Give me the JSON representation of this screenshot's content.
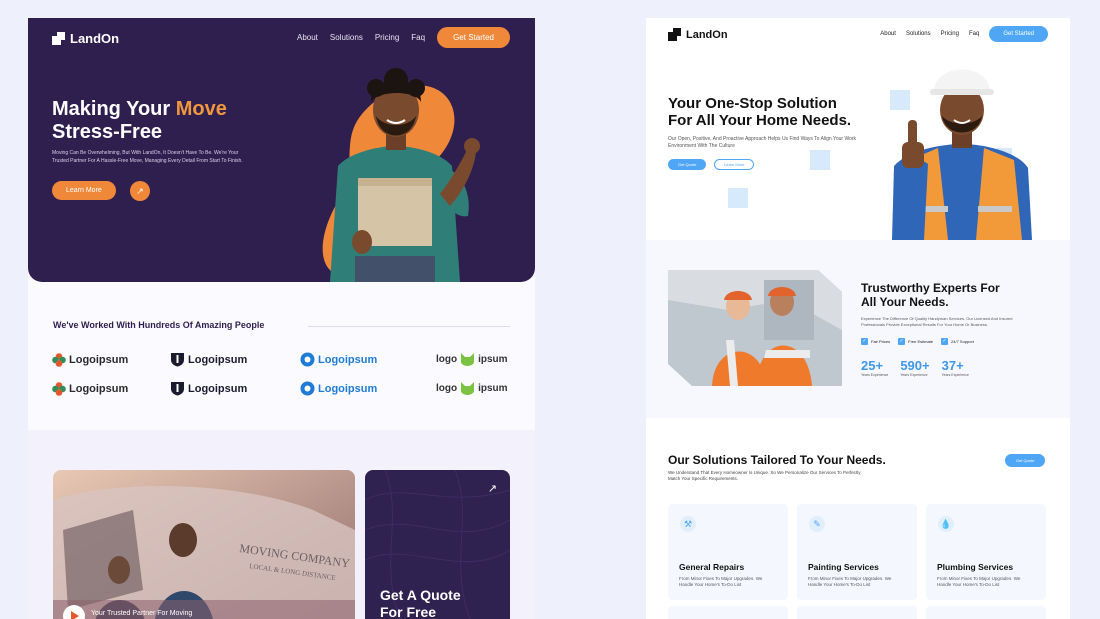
{
  "left": {
    "brand": "LandOn",
    "nav": [
      "About",
      "Solutions",
      "Pricing",
      "Faq"
    ],
    "cta": "Get Started",
    "hero": {
      "title_a": "Making Your ",
      "title_accent": "Move",
      "title_b": "Stress-Free",
      "desc": "Moving Can Be Overwhelming, But With LandOn, It Doesn't Have To Be. We're Your Trusted Partner For A Hassle-Free Move, Managing Every Detail From Start To Finish.",
      "button": "Learn More",
      "arrow": "↗"
    },
    "partners": {
      "heading": "We've Worked With Hundreds Of Amazing People",
      "logos": [
        "Logoipsum",
        "Logoipsum",
        "Logoipsum",
        "logo",
        "ipsum",
        "Logoipsum",
        "Logoipsum",
        "Logoipsum",
        "logo",
        "ipsum"
      ]
    },
    "van": {
      "sign_1": "MOVING COMPANY",
      "sign_2": "LOCAL & LONG DISTANCE",
      "caption": "Your Trusted Partner For Moving"
    },
    "quote": {
      "title": "Get A Quote For Free",
      "arrow": "↗"
    }
  },
  "right": {
    "brand": "LandOn",
    "nav": [
      "About",
      "Solutions",
      "Pricing",
      "Faq"
    ],
    "cta": "Get Started",
    "hero": {
      "title_1": "Your One-Stop Solution",
      "title_2": "For All Your Home Needs.",
      "desc": "Our Open, Positive, And Proactive Approach Helps Us Find Ways To Align Your Work Environment With The Culture",
      "btn_primary": "Get Quote",
      "btn_secondary": "Learn More"
    },
    "about": {
      "title_1": "Trustworthy Experts For",
      "title_2": "All Your Needs.",
      "desc": "Experience The Difference Of Quality Handyman Services. Our Licensed And Insured Professionals Provide Exceptional Results For Your Home Or Business.",
      "checks": [
        "Fair Prices",
        "Free Estimate",
        "24/7 Support"
      ],
      "stats": [
        {
          "num": "25+",
          "label": "Years Experience"
        },
        {
          "num": "590+",
          "label": "Years Experience"
        },
        {
          "num": "37+",
          "label": "Years Experience"
        }
      ]
    },
    "services": {
      "title": "Our Solutions Tailored To Your Needs.",
      "desc": "We Understand That Every Homeowner Is Unique. So We Personalize Our Services To Perfectly Match Your Specific Requirements.",
      "button": "Get Quote",
      "items": [
        {
          "title": "General Repairs",
          "desc": "From Minor Fixes To Major Upgrades. We Handle Your Home's To-Do List",
          "icon": "hammer"
        },
        {
          "title": "Painting Services",
          "desc": "From Minor Fixes To Major Upgrades. We Handle Your Home's To-Do List",
          "icon": "paint-brush"
        },
        {
          "title": "Plumbing Services",
          "desc": "From Minor Fixes To Major Upgrades. We Handle Your Home's To-Do List",
          "icon": "water-drop"
        }
      ]
    }
  },
  "colors": {
    "page_bg": "#eef0fb",
    "left_hero_bg": "#2e1f4f",
    "orange": "#f0883a",
    "blue": "#4ea6f5"
  }
}
